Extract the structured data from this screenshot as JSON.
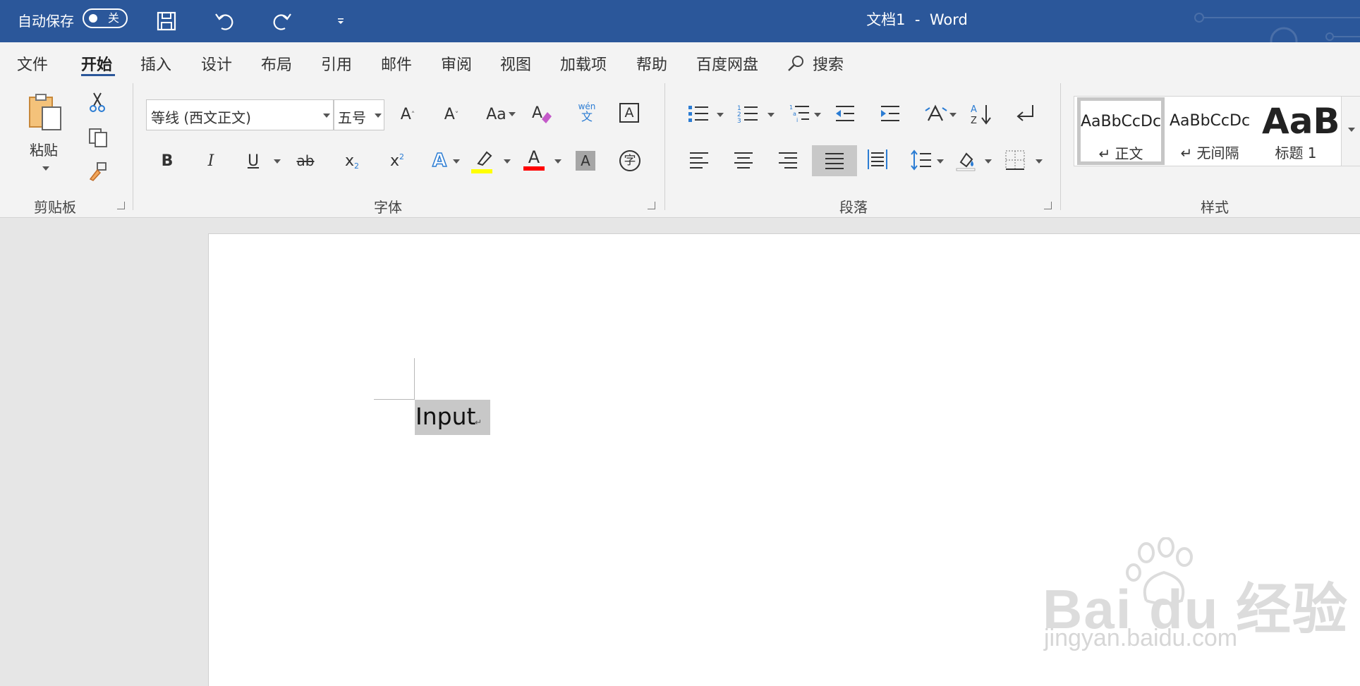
{
  "titlebar": {
    "autosave_label": "自动保存",
    "autosave_state": "关",
    "document_title": "文档1  -  Word",
    "accent_color": "#2b579a"
  },
  "menu": {
    "tabs": [
      {
        "label": "文件"
      },
      {
        "label": "开始"
      },
      {
        "label": "插入"
      },
      {
        "label": "设计"
      },
      {
        "label": "布局"
      },
      {
        "label": "引用"
      },
      {
        "label": "邮件"
      },
      {
        "label": "审阅"
      },
      {
        "label": "视图"
      },
      {
        "label": "加载项"
      },
      {
        "label": "帮助"
      },
      {
        "label": "百度网盘"
      }
    ],
    "active_tab": "开始",
    "search_label": "搜索"
  },
  "ribbon": {
    "clipboard": {
      "paste_label": "粘贴",
      "group_label": "剪贴板"
    },
    "font": {
      "font_name": "等线 (西文正文)",
      "font_size": "五号",
      "grow_label": "A",
      "shrink_label": "A",
      "case_label": "Aa",
      "phonetic_top": "wén",
      "phonetic_bottom": "文",
      "border_char": "A",
      "bold": "B",
      "italic": "I",
      "underline": "U",
      "strike": "ab",
      "subscript": "x",
      "superscript": "x",
      "effects": "A",
      "font_color_letter": "A",
      "shading_letter": "A",
      "enclose_char": "字",
      "highlight_color": "#ffff00",
      "font_color": "#ff0000",
      "group_label": "字体"
    },
    "paragraph": {
      "group_label": "段落"
    },
    "styles": {
      "items": [
        {
          "preview": "AaBbCcDc",
          "name": "↵ 正文"
        },
        {
          "preview": "AaBbCcDc",
          "name": "↵ 无间隔"
        },
        {
          "preview": "AaBb",
          "name": "标题 1"
        }
      ],
      "group_label": "样式"
    }
  },
  "document": {
    "text": "Input",
    "paragraph_mark": "↵"
  },
  "watermark": {
    "brand": "Bai du 经验",
    "url": "jingyan.baidu.com"
  }
}
